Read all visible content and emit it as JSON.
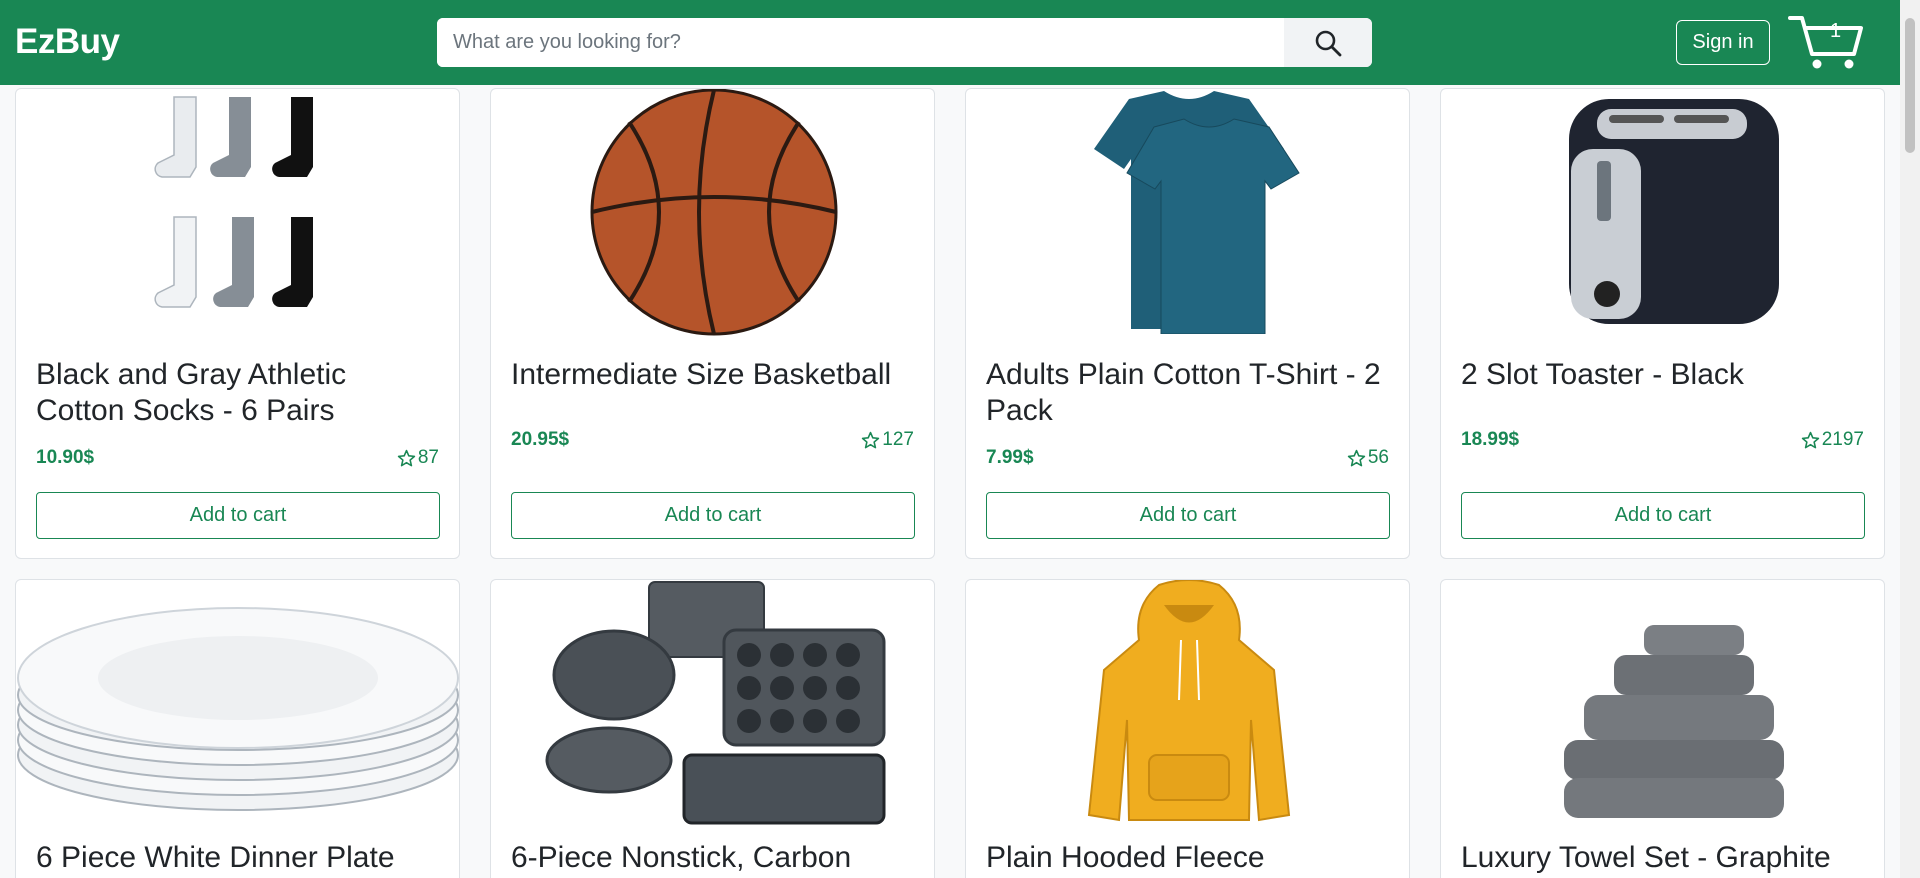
{
  "header": {
    "brand": "EzBuy",
    "search_placeholder": "What are you looking for?",
    "search_value": "",
    "signin_label": "Sign in",
    "cart_count": "1"
  },
  "products": [
    {
      "title": "Black and Gray Athletic Cotton Socks - 6 Pairs",
      "price": "10.90$",
      "rating": "87",
      "button": "Add to cart",
      "image": "socks-image"
    },
    {
      "title": "Intermediate Size Basketball",
      "price": "20.95$",
      "rating": "127",
      "button": "Add to cart",
      "image": "basketball-image"
    },
    {
      "title": "Adults Plain Cotton T-Shirt - 2 Pack",
      "price": "7.99$",
      "rating": "56",
      "button": "Add to cart",
      "image": "tshirt-image"
    },
    {
      "title": "2 Slot Toaster - Black",
      "price": "18.99$",
      "rating": "2197",
      "button": "Add to cart",
      "image": "toaster-image"
    },
    {
      "title": "6 Piece White Dinner Plate",
      "image": "plates-image"
    },
    {
      "title": "6-Piece Nonstick, Carbon",
      "image": "bakeware-image"
    },
    {
      "title": "Plain Hooded Fleece",
      "image": "hoodie-image"
    },
    {
      "title": "Luxury Towel Set - Graphite",
      "image": "towels-image"
    }
  ],
  "colors": {
    "brand_green": "#198754",
    "page_bg": "#f8f9fa"
  }
}
